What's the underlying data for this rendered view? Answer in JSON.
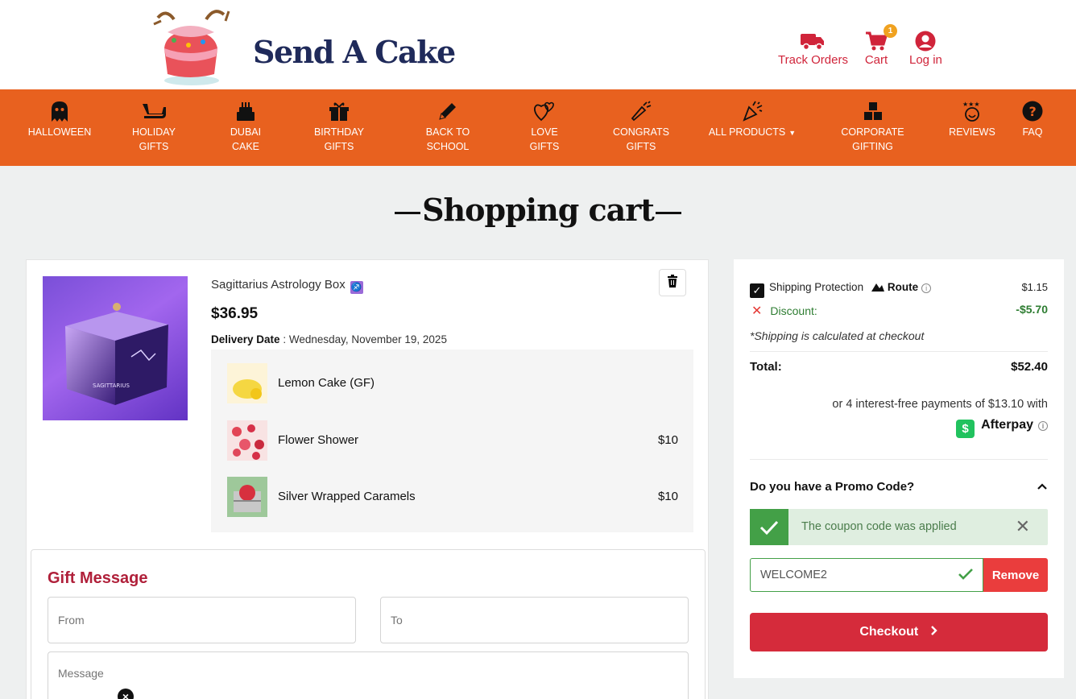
{
  "header": {
    "brand": "Send A Cake",
    "links": {
      "track_orders": "Track Orders",
      "cart": "Cart",
      "cart_count": "1",
      "log_in": "Log in"
    }
  },
  "nav": {
    "items": [
      {
        "line1": "HALLOWEEN",
        "line2": ""
      },
      {
        "line1": "HOLIDAY",
        "line2": "GIFTS"
      },
      {
        "line1": "DUBAI",
        "line2": "CAKE"
      },
      {
        "line1": "BIRTHDAY",
        "line2": "GIFTS"
      },
      {
        "line1": "BACK TO",
        "line2": "SCHOOL"
      },
      {
        "line1": "LOVE",
        "line2": "GIFTS"
      },
      {
        "line1": "CONGRATS",
        "line2": "GIFTS"
      },
      {
        "line1": "ALL PRODUCTS",
        "line2": ""
      },
      {
        "line1": "CORPORATE",
        "line2": "GIFTING"
      },
      {
        "line1": "REVIEWS",
        "line2": ""
      },
      {
        "line1": "FAQ",
        "line2": ""
      }
    ]
  },
  "page_title": "Shopping cart",
  "cart": {
    "product": {
      "name": "Sagittarius Astrology Box",
      "zodiac_symbol": "♐",
      "price": "$36.95",
      "delivery_label": "Delivery Date",
      "delivery_value": ": Wednesday, November 19, 2025",
      "box_text": "SAGITTARIUS"
    },
    "addons": [
      {
        "name": "Lemon Cake (GF)",
        "price": ""
      },
      {
        "name": "Flower Shower",
        "price": "$10"
      },
      {
        "name": "Silver Wrapped Caramels",
        "price": "$10"
      }
    ],
    "gift_message": {
      "title": "Gift Message",
      "from_placeholder": "From",
      "to_placeholder": "To",
      "message_placeholder": "Message"
    }
  },
  "summary": {
    "shipping_protection_label": "Shipping Protection",
    "route_label": "Route",
    "shipping_protection_price": "$1.15",
    "discount_label": "Discount:",
    "discount_value": "-$5.70",
    "shipping_note": "*Shipping is calculated at checkout",
    "total_label": "Total:",
    "total_value": "$52.40",
    "afterpay_text": "or 4 interest-free payments of $13.10 with",
    "afterpay_brand": "Afterpay",
    "promo_question": "Do you have a Promo Code?",
    "applied_message": "The coupon code was applied",
    "coupon_value": "WELCOME2",
    "remove_label": "Remove",
    "checkout_label": "Checkout"
  },
  "colors": {
    "nav_bg": "#e8611f",
    "brand_navy": "#1f2a5a",
    "accent_red": "#d52b3b",
    "success_green": "#43a047",
    "discount_green": "#2e7d32"
  }
}
